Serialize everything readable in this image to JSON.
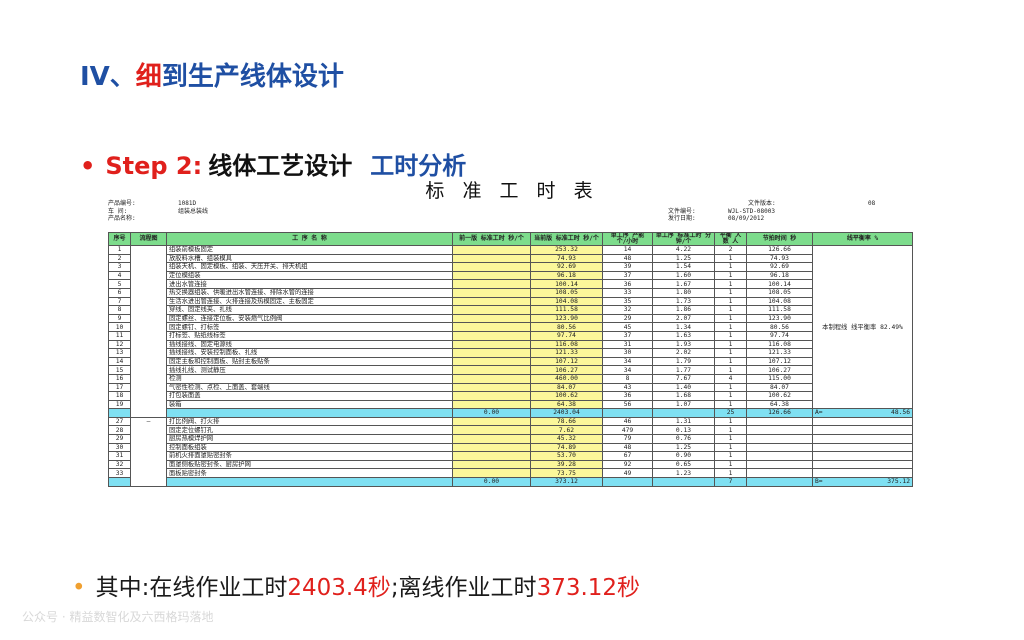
{
  "title": {
    "prefix": "IV、",
    "highlight": "细",
    "rest": "到生产线体设计"
  },
  "step": {
    "bullet": "•",
    "label": "Step 2:",
    "main": "线体工艺设计",
    "sub": "工时分析"
  },
  "table_title": "标 准 工 时 表",
  "meta": {
    "product_label": "产品编号:",
    "product_value": "1081D",
    "version_label": "文件版本:",
    "version_value": "08",
    "area_label": "车 间:",
    "area_value": "组装总装线",
    "doc_label": "文件编号:",
    "doc_value": "WJL-STD-08003",
    "name_label": "产品名称:",
    "date_label": "发行日期:",
    "date_value": "08/09/2012"
  },
  "headers": [
    "序号",
    "流程图",
    "工 序 名 称",
    "前一版 标准工时 秒/个",
    "当前版 标准工时 秒/个",
    "单工序 产能 个/小时",
    "单工序 标准工时 分钟/个",
    "平衡 人数 人",
    "节拍时间 秒",
    "线平衡率 %"
  ],
  "balance_note": "本制程线 线平衡率 82.49%",
  "rows_online": [
    {
      "no": "1",
      "name": "组装前模板固定",
      "cur": "253.32",
      "cap": "14",
      "min": "4.22",
      "ppl": "2",
      "tact": "126.66"
    },
    {
      "no": "2",
      "name": "放胶料水槽、组装模具",
      "cur": "74.93",
      "cap": "48",
      "min": "1.25",
      "ppl": "1",
      "tact": "74.93"
    },
    {
      "no": "3",
      "name": "组装天机、固定模板、组装、天压开关、排天机组",
      "cur": "92.69",
      "cap": "39",
      "min": "1.54",
      "ppl": "1",
      "tact": "92.69"
    },
    {
      "no": "4",
      "name": "定位模组装",
      "cur": "96.18",
      "cap": "37",
      "min": "1.60",
      "ppl": "1",
      "tact": "96.18"
    },
    {
      "no": "5",
      "name": "进出水管连接",
      "cur": "100.14",
      "cap": "36",
      "min": "1.67",
      "ppl": "1",
      "tact": "100.14"
    },
    {
      "no": "6",
      "name": "热交换器组装、供暖进出水管连接、排除水管的连接",
      "cur": "108.05",
      "cap": "33",
      "min": "1.80",
      "ppl": "1",
      "tact": "108.05"
    },
    {
      "no": "7",
      "name": "生活水进出管连接、火排连接及热模固定、主板固定",
      "cur": "104.08",
      "cap": "35",
      "min": "1.73",
      "ppl": "1",
      "tact": "104.08"
    },
    {
      "no": "8",
      "name": "穿线、固定线夹、扎线",
      "cur": "111.58",
      "cap": "32",
      "min": "1.86",
      "ppl": "1",
      "tact": "111.58"
    },
    {
      "no": "9",
      "name": "固定螺丝、连接定位板、安装燃气比例阀",
      "cur": "123.90",
      "cap": "29",
      "min": "2.07",
      "ppl": "1",
      "tact": "123.90"
    },
    {
      "no": "10",
      "name": "固定螺钉、打标签",
      "cur": "80.56",
      "cap": "45",
      "min": "1.34",
      "ppl": "1",
      "tact": "80.56"
    },
    {
      "no": "11",
      "name": "打标签、贴纸线标签",
      "cur": "97.74",
      "cap": "37",
      "min": "1.63",
      "ppl": "1",
      "tact": "97.74"
    },
    {
      "no": "12",
      "name": "插线接线、固定电源线",
      "cur": "116.08",
      "cap": "31",
      "min": "1.93",
      "ppl": "1",
      "tact": "116.08"
    },
    {
      "no": "13",
      "name": "插线接线、安装控制面板、扎线",
      "cur": "121.33",
      "cap": "30",
      "min": "2.02",
      "ppl": "1",
      "tact": "121.33"
    },
    {
      "no": "14",
      "name": "固定主板和控制面板、贴封主板贴条",
      "cur": "107.12",
      "cap": "34",
      "min": "1.79",
      "ppl": "1",
      "tact": "107.12"
    },
    {
      "no": "15",
      "name": "插线扎线、测试静压",
      "cur": "106.27",
      "cap": "34",
      "min": "1.77",
      "ppl": "1",
      "tact": "106.27"
    },
    {
      "no": "16",
      "name": "检测",
      "cur": "460.00",
      "cap": "8",
      "min": "7.67",
      "ppl": "4",
      "tact": "115.00"
    },
    {
      "no": "17",
      "name": "气密性检测、点检、上面盖、套端线",
      "cur": "84.07",
      "cap": "43",
      "min": "1.40",
      "ppl": "1",
      "tact": "84.07"
    },
    {
      "no": "18",
      "name": "打包装面盖",
      "cur": "100.62",
      "cap": "36",
      "min": "1.68",
      "ppl": "1",
      "tact": "100.62"
    },
    {
      "no": "19",
      "name": "装箱",
      "cur": "64.38",
      "cap": "56",
      "min": "1.07",
      "ppl": "1",
      "tact": "64.38"
    }
  ],
  "sum_online": {
    "prev": "0.00",
    "cur": "2403.04",
    "ppl": "25",
    "tact": "126.66",
    "lab": "A=",
    "val": "48.56"
  },
  "rows_offline": [
    {
      "no": "27",
      "name": "打比例阀、打火排",
      "cur": "78.66",
      "cap": "46",
      "min": "1.31",
      "ppl": "1"
    },
    {
      "no": "28",
      "name": "固定定位螺钉孔",
      "cur": "7.62",
      "cap": "479",
      "min": "0.13",
      "ppl": "1"
    },
    {
      "no": "29",
      "name": "厨房热模焊护网",
      "cur": "45.32",
      "cap": "79",
      "min": "0.76",
      "ppl": "1"
    },
    {
      "no": "30",
      "name": "控制面板组装",
      "cur": "74.89",
      "cap": "48",
      "min": "1.25",
      "ppl": "1"
    },
    {
      "no": "31",
      "name": "前机火排面罩贴密封条",
      "cur": "53.70",
      "cap": "67",
      "min": "0.90",
      "ppl": "1"
    },
    {
      "no": "32",
      "name": "面罩侧板贴密封条、厨房护网",
      "cur": "39.28",
      "cap": "92",
      "min": "0.65",
      "ppl": "1"
    },
    {
      "no": "33",
      "name": "面板贴密封条",
      "cur": "73.75",
      "cap": "49",
      "min": "1.23",
      "ppl": "1"
    }
  ],
  "sum_offline": {
    "prev": "0.00",
    "cur": "373.12",
    "ppl": "7",
    "lab": "B=",
    "val": "375.12"
  },
  "note": {
    "bullet": "•",
    "text1": "其中:在线作业工时",
    "v1": "2403.4秒",
    "text2": ";离线作业工时",
    "v2": "373.12秒"
  },
  "watermark": "公众号 · 精益数智化及六西格玛落地"
}
